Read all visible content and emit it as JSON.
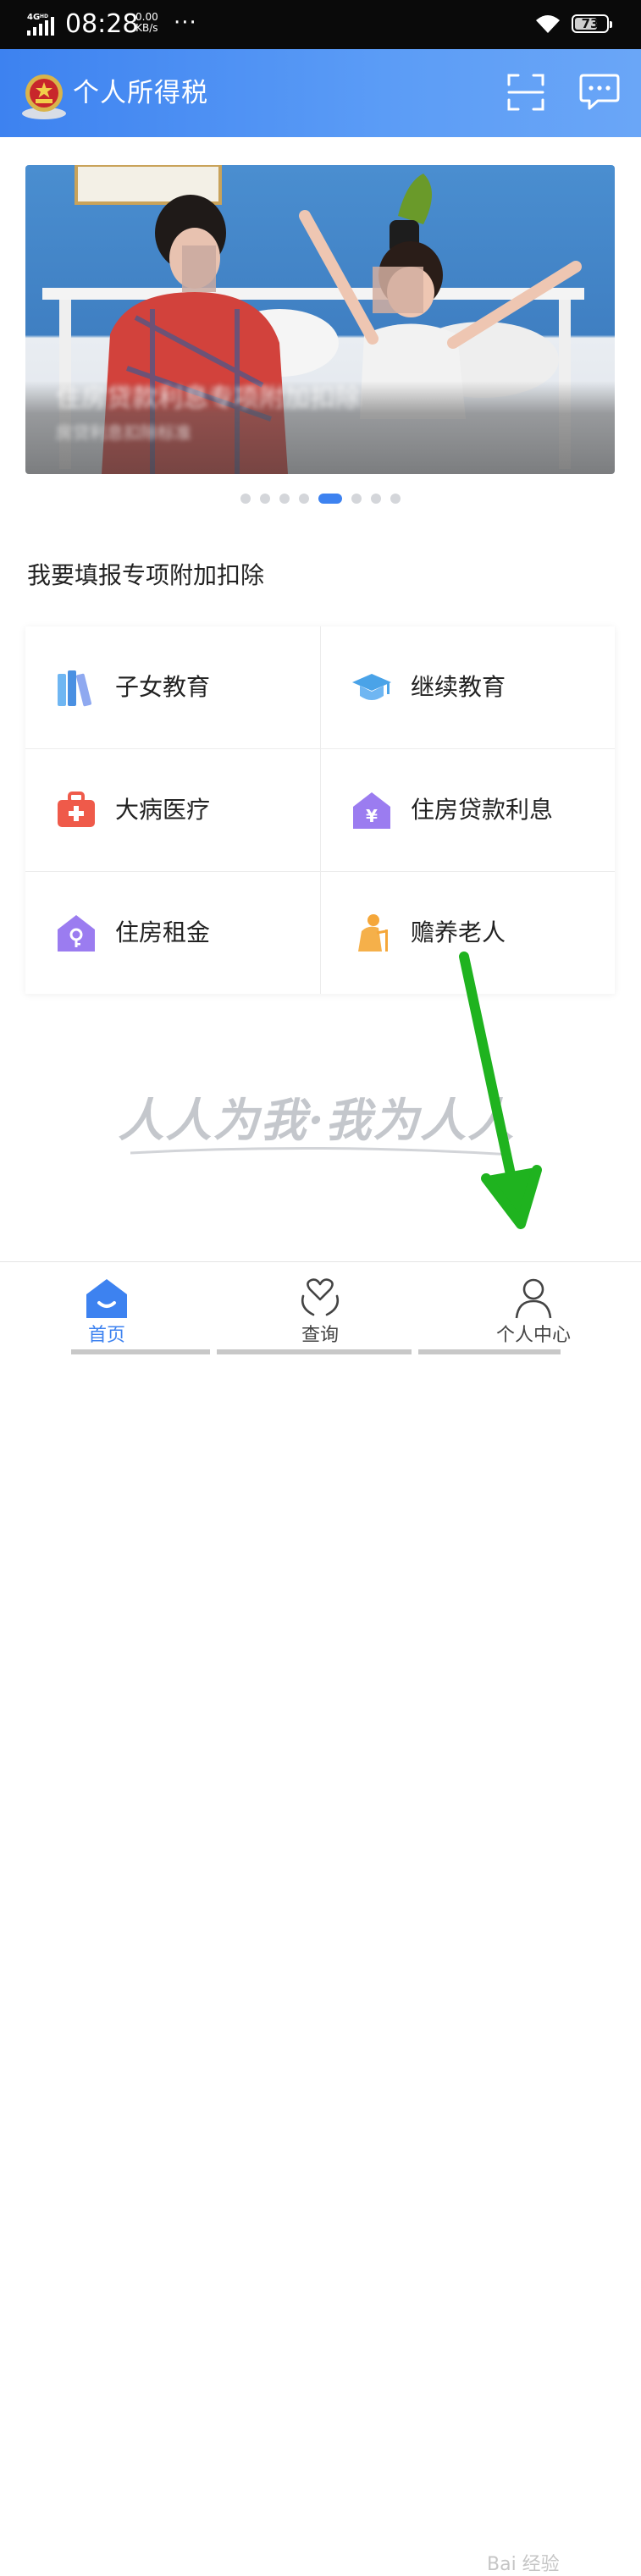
{
  "status_bar": {
    "network": "4G HD",
    "time": "08:28",
    "speed_value": "0.00",
    "speed_unit": "KB/s",
    "more": "···",
    "battery": "73"
  },
  "header": {
    "title": "个人所得税",
    "emblem_icon": "national-emblem-icon",
    "scan_icon": "scan-icon",
    "message_icon": "message-icon"
  },
  "banner": {
    "caption": "住房贷款利息专项附加扣除",
    "subcaption": "房贷利息扣除标准"
  },
  "carousel": {
    "count": 8,
    "active_index": 4
  },
  "section": {
    "title": "我要填报专项附加扣除"
  },
  "deductions": [
    {
      "label": "子女教育",
      "icon": "books-icon"
    },
    {
      "label": "继续教育",
      "icon": "graduation-cap-icon"
    },
    {
      "label": "大病医疗",
      "icon": "medical-kit-icon"
    },
    {
      "label": "住房贷款利息",
      "icon": "house-yuan-icon"
    },
    {
      "label": "住房租金",
      "icon": "house-key-icon"
    },
    {
      "label": "赡养老人",
      "icon": "elderly-icon"
    }
  ],
  "slogan": "人人为我·我为人人",
  "tabs": [
    {
      "label": "首页",
      "icon": "home-icon",
      "active": true
    },
    {
      "label": "查询",
      "icon": "heart-hands-icon",
      "active": false
    },
    {
      "label": "个人中心",
      "icon": "user-icon",
      "active": false
    }
  ],
  "watermark": "Bai 经验",
  "colors": {
    "brand_blue": "#3d82f0",
    "annotation_green": "#1fb31f"
  }
}
